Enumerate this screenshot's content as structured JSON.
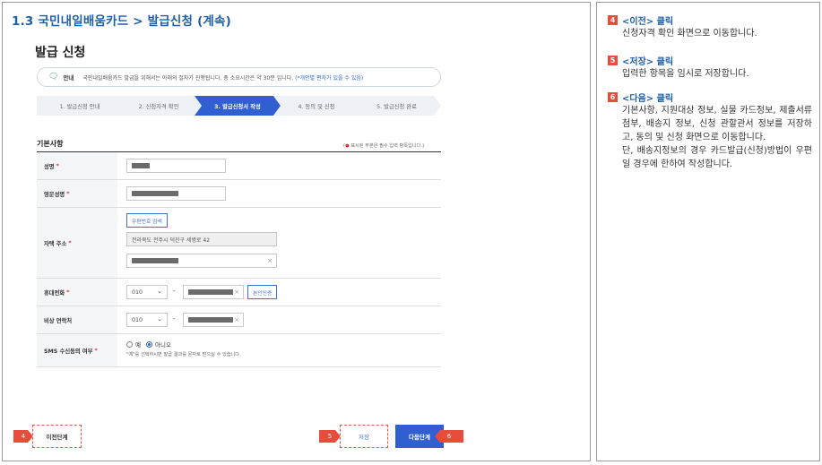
{
  "section_title": "1.3 국민내일배움카드 > 발급신청 (계속)",
  "page_title": "발급 신청",
  "notice": {
    "label": "안내",
    "text": "국민내일배움카드 발급을 위해서는 아래의 절차가 진행됩니다. 총 소요시간은 약 30분 입니다.",
    "note": "(*개인별 편차가 있을 수 있음)"
  },
  "steps": [
    {
      "label": "1. 발급신청 안내",
      "active": false
    },
    {
      "label": "2. 신청자격 확인",
      "active": false
    },
    {
      "label": "3. 발급신청서 작성",
      "active": true
    },
    {
      "label": "4. 동의 및 신청",
      "active": false
    },
    {
      "label": "5. 발급신청 완료",
      "active": false
    }
  ],
  "form": {
    "heading": "기본사항",
    "required_note_mark": "●",
    "required_note": "표시된 부분은 필수 입력 항목입니다.",
    "rows": {
      "name": {
        "label": "성명",
        "required": "*"
      },
      "eng_name": {
        "label": "영문성명",
        "required": "*"
      },
      "address": {
        "label": "자택 주소",
        "required": "*",
        "search_button": "우편번호 검색",
        "address_value": "전라북도 전주시 덕진구 세병로 42"
      },
      "mobile": {
        "label": "휴대전화",
        "required": "*",
        "prefix": "010",
        "dash": "-",
        "verify_button": "본인인증"
      },
      "emergency": {
        "label": "비상 연락처",
        "prefix": "010",
        "dash": "-"
      },
      "sms": {
        "label": "SMS 수신동의 여부",
        "required": "*",
        "option_yes": "예",
        "option_no": "아니오",
        "selected": "아니오",
        "hint": "\"예\"를 선택하시면 발급 결과를 문자로 받으실 수 있습니다."
      }
    }
  },
  "clear_glyph": "×",
  "buttons": {
    "prev": "이전단계",
    "save": "저장",
    "next": "다음단계"
  },
  "markers": {
    "prev": "4",
    "save": "5",
    "next": "6"
  },
  "explanations": [
    {
      "num": "4",
      "title": "<이전> 클릭",
      "lines": [
        "신청자격 확인 화면으로 이동합니다."
      ]
    },
    {
      "num": "5",
      "title": "<저장> 클릭",
      "lines": [
        "입력한 항목을 임시로 저장합니다."
      ]
    },
    {
      "num": "6",
      "title": "<다음> 클릭",
      "lines": [
        "기본사항, 지원대상 정보, 실물 카드정보, 제출서류 첨부, 배송지 정보, 신청 관할관서 정보를 저장하고, 동의 및 신청 화면으로 이동합니다.",
        "단, 배송지정보의 경우 카드발급(신청)방법이 우편일 경우에 한하여 작성합니다."
      ]
    }
  ],
  "colors": {
    "accent": "#2f5fd0",
    "title_blue": "#1f5fa8",
    "marker_red": "#e74c3c",
    "required_red": "#d9342b"
  },
  "icons": {
    "notice": "speech-bubble-icon",
    "select": "chevron-down-icon",
    "clear": "close-icon"
  }
}
